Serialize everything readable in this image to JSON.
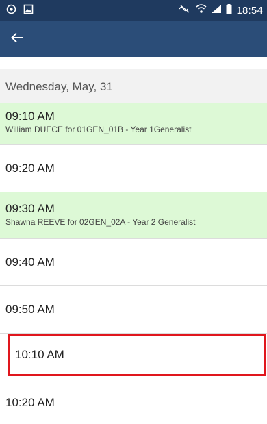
{
  "status_bar": {
    "time": "18:54",
    "left_icons": [
      "settings-circle-icon",
      "image-icon"
    ],
    "right_icons": [
      "muted-icon",
      "wifi-icon",
      "signal-icon",
      "battery-icon"
    ]
  },
  "app_bar": {
    "back_icon": "arrow-left-icon"
  },
  "schedule": {
    "date": "Wednesday, May, 31",
    "slots": [
      {
        "time": "09:10 AM",
        "detail": "William DUECE for 01GEN_01B - Year 1Generalist",
        "booked": true
      },
      {
        "time": "09:20 AM",
        "detail": "",
        "booked": false
      },
      {
        "time": "09:30 AM",
        "detail": "Shawna REEVE for 02GEN_02A - Year 2 Generalist",
        "booked": true
      },
      {
        "time": "09:40 AM",
        "detail": "",
        "booked": false
      },
      {
        "time": "09:50 AM",
        "detail": "",
        "booked": false
      },
      {
        "time": "10:10 AM",
        "detail": "",
        "booked": false,
        "highlighted": true
      },
      {
        "time": "10:20 AM",
        "detail": "",
        "booked": false
      }
    ]
  },
  "colors": {
    "status_bar": "#1f3a5f",
    "app_bar": "#2b4d78",
    "booked_slot": "#ddf9d6",
    "highlight_border": "#e0161d",
    "date_header_bg": "#f2f2f2"
  }
}
